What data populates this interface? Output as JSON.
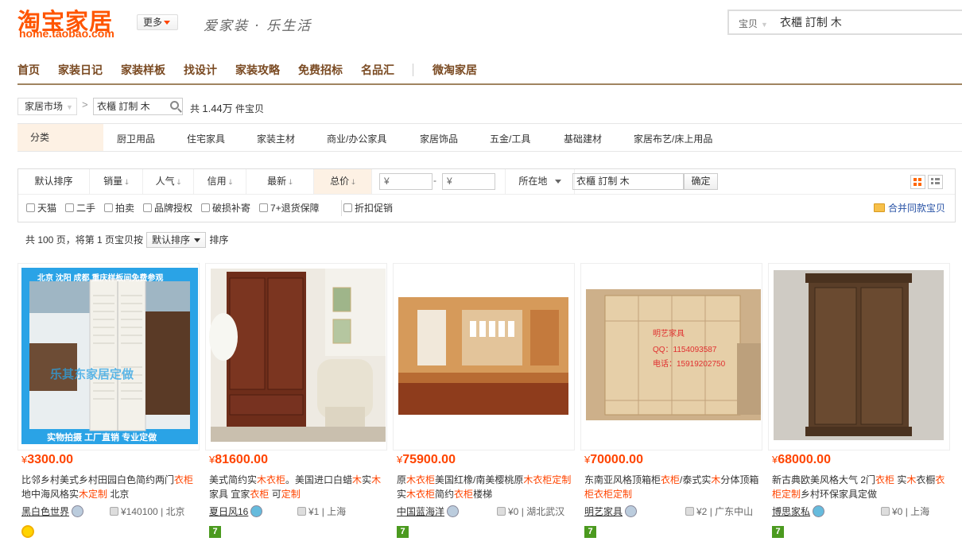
{
  "brand": {
    "logo_text": "淘宝家居",
    "logo_sub": "home.taobao.com",
    "more": "更多",
    "slogan": "爱家装 · 乐生活"
  },
  "top_search": {
    "category": "宝贝",
    "query": "衣櫃 訂制 木"
  },
  "nav": [
    "首页",
    "家装日记",
    "家装样板",
    "找设计",
    "家装攻略",
    "免费招标",
    "名品汇",
    "微淘家居"
  ],
  "breadcrumb": {
    "market": "家居市场",
    "query": "衣櫃 訂制 木",
    "count_prefix": "共",
    "count": "1.44万",
    "count_suffix": "件宝贝"
  },
  "categories": {
    "label": "分类",
    "items": [
      "厨卫用品",
      "住宅家具",
      "家装主材",
      "商业/办公家具",
      "家居饰品",
      "五金/工具",
      "基础建材",
      "家居布艺/床上用品"
    ]
  },
  "sort": {
    "items": [
      "默认排序",
      "销量",
      "人气",
      "信用",
      "最新",
      "总价"
    ],
    "price_from": "¥",
    "price_to": "¥",
    "dash": "-",
    "location": "所在地",
    "keyword": "衣櫃 訂制 木",
    "confirm": "确定"
  },
  "checks": [
    "天猫",
    "二手",
    "拍卖",
    "品牌授权",
    "破损补寄",
    "7+退货保障",
    "折扣促销"
  ],
  "merge": "合并同款宝贝",
  "paging": {
    "text1": "共 100 页，将第 1 页宝贝按",
    "sort": "默认排序",
    "text2": "排序"
  },
  "products": [
    {
      "price": "3300.00",
      "title_parts": [
        "比邻乡村美式乡村田园白色简约两门",
        "衣柜",
        "地中海风格实",
        "木",
        "",
        "定制",
        " 北京"
      ],
      "seller": "黑白色世界",
      "sales": "¥140100",
      "city": "北京",
      "img_top": "北京 沈阳 成都 重庆样板间免费参观",
      "img_mid": "乐其东家居定做",
      "img_bottom": "实物拍摄 工厂直销 专业定做"
    },
    {
      "price": "81600.00",
      "title_parts": [
        "美式简约实",
        "木衣柜",
        "。美国进口白蜡",
        "木",
        "实",
        "木",
        "家具 宜家",
        "衣柜",
        " 可",
        "定制"
      ],
      "seller": "夏日风16",
      "sales": "¥1",
      "city": "上海"
    },
    {
      "price": "75900.00",
      "title_parts": [
        "原",
        "木衣柜",
        "美国红橡/南美樱桃原",
        "木衣柜定制",
        "实",
        "木衣柜",
        "简约",
        "衣柜",
        "楼梯"
      ],
      "seller": "中国蓝海洋",
      "sales": "¥0",
      "city": "湖北武汉"
    },
    {
      "price": "70000.00",
      "title_parts": [
        "东南亚风格顶箱柜",
        "衣柜",
        "/泰式实",
        "木",
        "分体顶箱",
        "柜衣柜定制"
      ],
      "seller": "明艺家具",
      "sales": "¥2",
      "city": "广东中山",
      "img_txt1": "明艺家具",
      "img_txt2": "QQ：1154093587",
      "img_txt3": "电话：15919202750"
    },
    {
      "price": "68000.00",
      "title_parts": [
        "新古典欧美风格大气 2门",
        "衣柜",
        " 实",
        "木",
        "衣橱",
        "衣柜定制",
        "乡村环保家具定做"
      ],
      "seller": "博思家私",
      "sales": "¥0",
      "city": "上海"
    }
  ],
  "currency": "¥",
  "badge": "7",
  "sep": "|"
}
